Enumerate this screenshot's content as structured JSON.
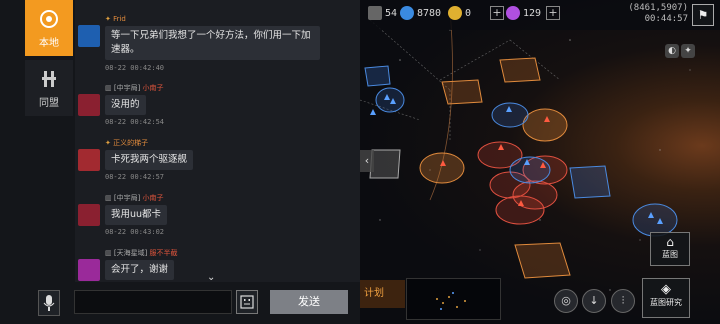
{
  "tabs": {
    "local": "本地",
    "alliance": "同盟"
  },
  "chat": {
    "messages": [
      {
        "guild": "",
        "name": "Frid",
        "text": "等一下兄弟们我想了一个好方法，你们用一下加速器。",
        "time": "08-22 00:42:40",
        "avatar_color": "#1e5fb0"
      },
      {
        "guild": "[中宇局]",
        "name": "小南子",
        "text": "没用的",
        "time": "08-22 00:42:54",
        "avatar_color": "#8a2030"
      },
      {
        "guild": "",
        "name": "正义的梯子",
        "text": "卡死我两个驱逐舰",
        "time": "08-22 00:42:57",
        "avatar_color": "#a22a30"
      },
      {
        "guild": "[中宇局]",
        "name": "小南子",
        "text": "我用uu都卡",
        "time": "08-22 00:43:02",
        "avatar_color": "#8a2030"
      },
      {
        "guild": "[天海星域]",
        "name": "服不半截",
        "text": "会开了，谢谢",
        "time": "",
        "avatar_color": "#9a2a9a"
      }
    ]
  },
  "input": {
    "placeholder": "",
    "send_label": "发送"
  },
  "resources": [
    {
      "value": "54",
      "icon": "ship-icon",
      "color": "#888888"
    },
    {
      "value": "8780",
      "icon": "crystal-icon",
      "color": "#3a8ae0"
    },
    {
      "value": "0",
      "icon": "gold-icon",
      "color": "#e0b030"
    },
    {
      "value": "129",
      "icon": "gem-icon",
      "color": "#b050e0"
    }
  ],
  "coords": {
    "position": "(8461,5907)",
    "clock": "00:44:57"
  },
  "map_buttons": {
    "plan": "计划",
    "blueprint": "蓝图",
    "blueprint_research": "蓝图研究"
  }
}
